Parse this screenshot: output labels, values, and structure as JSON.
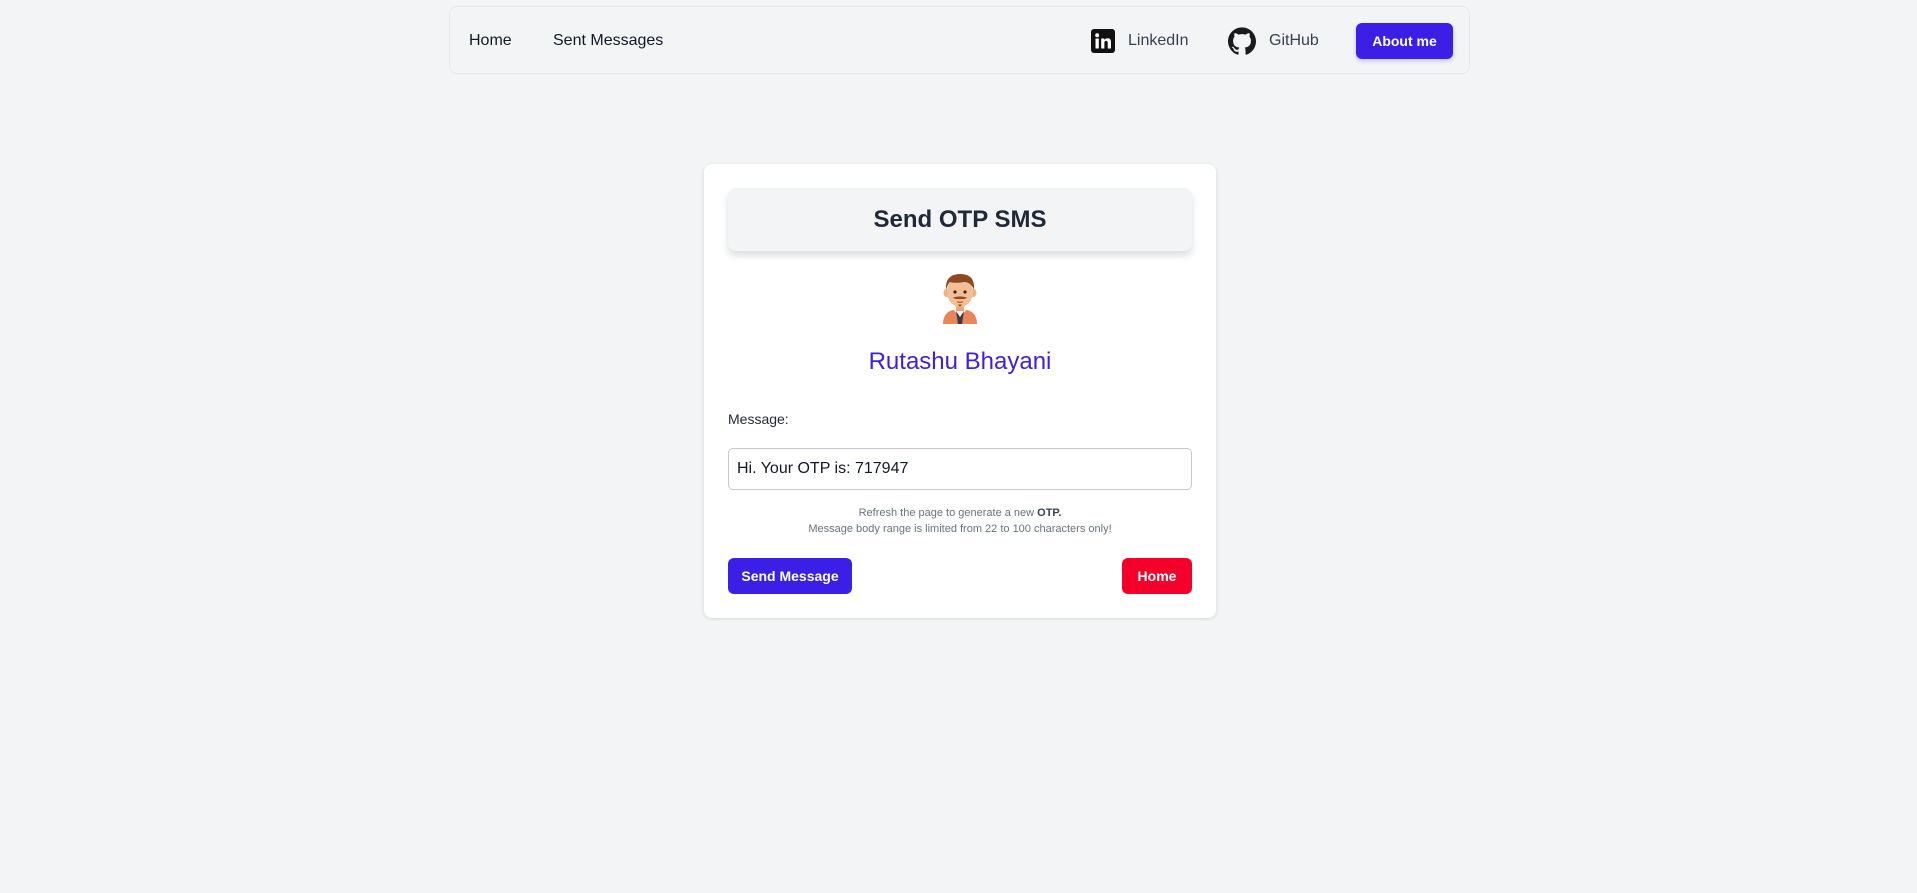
{
  "nav": {
    "home": "Home",
    "sent_messages": "Sent Messages",
    "linkedin": "LinkedIn",
    "linkedin_icon": "linkedin-icon",
    "github": "GitHub",
    "github_icon": "github-icon",
    "about": "About me"
  },
  "card": {
    "title": "Send OTP SMS",
    "avatar_icon": "person-avatar-icon",
    "user_name": "Rutashu Bhayani",
    "message_label": "Message:",
    "message_value": "Hi. Your OTP is: 717947",
    "hint_prefix": "Refresh the page to generate a new",
    "hint_bold": "OTP.",
    "hint_limit": "Message body range is limited from 22 to 100 characters only!",
    "send_button": "Send Message",
    "home_button": "Home"
  },
  "colors": {
    "primary": "#3b1fe6",
    "danger": "#f5002a",
    "background": "#f3f4f6"
  }
}
